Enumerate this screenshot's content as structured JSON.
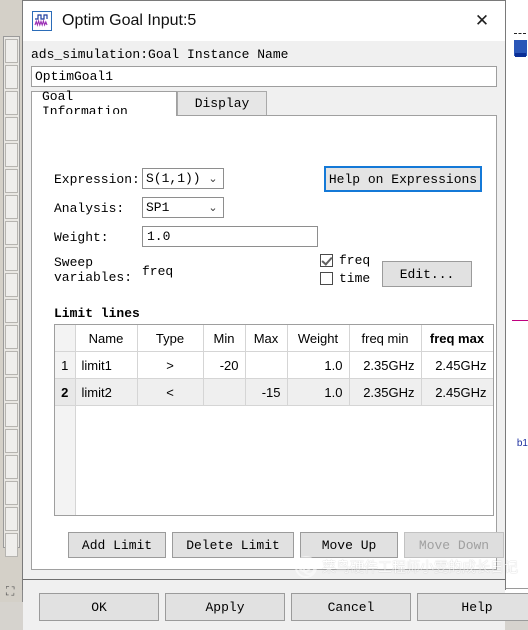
{
  "window": {
    "title": "Optim Goal Input:5",
    "icon": "waveform-icon",
    "close_label": "✕"
  },
  "instance": {
    "label": "ads_simulation:Goal Instance Name",
    "value": "OptimGoal1",
    "placeholder": ""
  },
  "tabs": [
    {
      "label": "Goal Information",
      "active": true
    },
    {
      "label": "Display",
      "active": false
    }
  ],
  "form": {
    "expression": {
      "label": "Expression:",
      "value": "S(1,1))",
      "chevron": "⌄"
    },
    "analysis": {
      "label": "Analysis:",
      "value": "SP1",
      "chevron": "⌄"
    },
    "weight": {
      "label": "Weight:",
      "value": "1.0"
    },
    "sweep": {
      "label_line1": "Sweep",
      "label_line2": "variables:",
      "value": "freq"
    },
    "help_button": "Help on Expressions",
    "edit_button": "Edit...",
    "checkboxes": [
      {
        "label": "freq",
        "checked": true
      },
      {
        "label": "time",
        "checked": false
      }
    ]
  },
  "limit_lines": {
    "title": "Limit lines",
    "columns": [
      {
        "key": "rownum",
        "label": "",
        "bold": false
      },
      {
        "key": "name",
        "label": "Name",
        "bold": false
      },
      {
        "key": "type",
        "label": "Type",
        "bold": false
      },
      {
        "key": "min",
        "label": "Min",
        "bold": false
      },
      {
        "key": "max",
        "label": "Max",
        "bold": false
      },
      {
        "key": "weight",
        "label": "Weight",
        "bold": false
      },
      {
        "key": "freq_min",
        "label": "freq min",
        "bold": false
      },
      {
        "key": "freq_max",
        "label": "freq max",
        "bold": true
      }
    ],
    "rows": [
      {
        "rownum": "1",
        "name": "limit1",
        "type": ">",
        "min": "-20",
        "max": "",
        "weight": "1.0",
        "freq_min": "2.35GHz",
        "freq_max": "2.45GHz",
        "selected": false
      },
      {
        "rownum": "2",
        "name": "limit2",
        "type": "<",
        "min": "",
        "max": "-15",
        "weight": "1.0",
        "freq_min": "2.35GHz",
        "freq_max": "2.45GHz",
        "selected": true
      }
    ],
    "buttons": [
      {
        "label": "Add Limit",
        "disabled": false
      },
      {
        "label": "Delete Limit",
        "disabled": false
      },
      {
        "label": "Move Up",
        "disabled": false
      },
      {
        "label": "Move Down",
        "disabled": true
      }
    ]
  },
  "footer": {
    "buttons": [
      {
        "label": "OK"
      },
      {
        "label": "Apply"
      },
      {
        "label": "Cancel"
      },
      {
        "label": "Help"
      }
    ]
  },
  "watermark": {
    "text": "菜鸟硬件工程师小雯的成长日记",
    "logo": "wechat-icon"
  },
  "background": {
    "right_label": "b1",
    "bottom_glyph": "⛶"
  },
  "colors": {
    "focus_blue": "#1479d7",
    "dialog_bg": "#f0f0f0",
    "panel_bg": "#ffffff",
    "selection_gray": "#efefef"
  }
}
